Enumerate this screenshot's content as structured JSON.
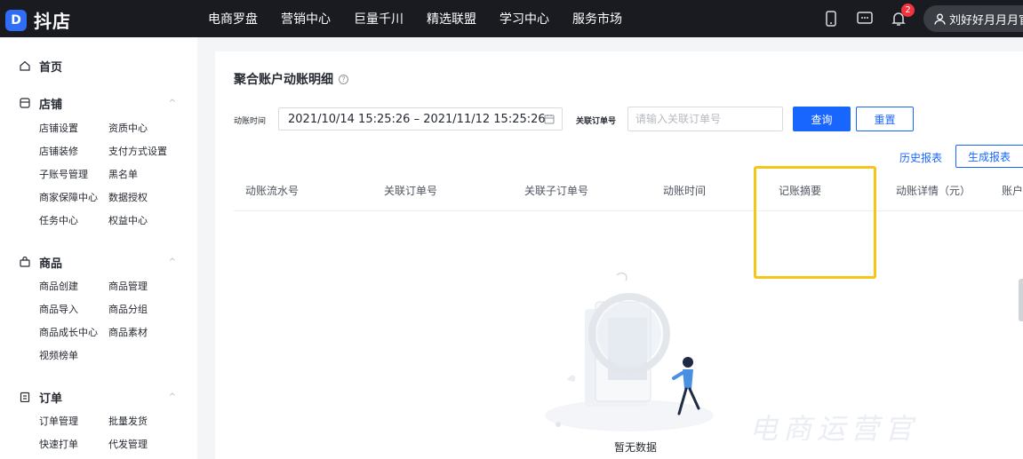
{
  "app": {
    "logo_mark": "D",
    "name": "抖店"
  },
  "topnav": [
    "电商罗盘",
    "营销中心",
    "巨量千川",
    "精选联盟",
    "学习中心",
    "服务市场"
  ],
  "top_right": {
    "notification_count": "2",
    "user_name": "刘好好月月月官"
  },
  "sidebar": {
    "home": "首页",
    "shop": {
      "title": "店铺",
      "items": [
        "店铺设置",
        "资质中心",
        "店铺装修",
        "支付方式设置",
        "子账号管理",
        "黑名单",
        "商家保障中心",
        "数据授权",
        "任务中心",
        "权益中心"
      ]
    },
    "goods": {
      "title": "商品",
      "items": [
        "商品创建",
        "商品管理",
        "商品导入",
        "商品分组",
        "商品成长中心",
        "商品素材",
        "视频榜单"
      ]
    },
    "orders": {
      "title": "订单",
      "items": [
        "订单管理",
        "批量发货",
        "快速打单",
        "代发管理"
      ]
    }
  },
  "main": {
    "title": "聚合账户动账明细",
    "filters": {
      "time_label": "动账时间",
      "time_value": "2021/10/14 15:25:26  – 2021/11/12 15:25:26",
      "order_label": "关联订单号",
      "order_placeholder": "请输入关联订单号",
      "query_button": "查询",
      "reset_button": "重置"
    },
    "history_link": "历史报表",
    "generate_button": "生成报表",
    "columns": [
      "动账流水号",
      "关联订单号",
      "关联子订单号",
      "动账时间",
      "记账摘要",
      "动账详情（元）",
      "账户"
    ],
    "empty_text": "暂无数据"
  },
  "watermark": "电商运营官",
  "colors": {
    "topbar": "#191b20",
    "primary": "#1966ff",
    "highlight": "#f5c518",
    "badge": "#f5333f"
  }
}
